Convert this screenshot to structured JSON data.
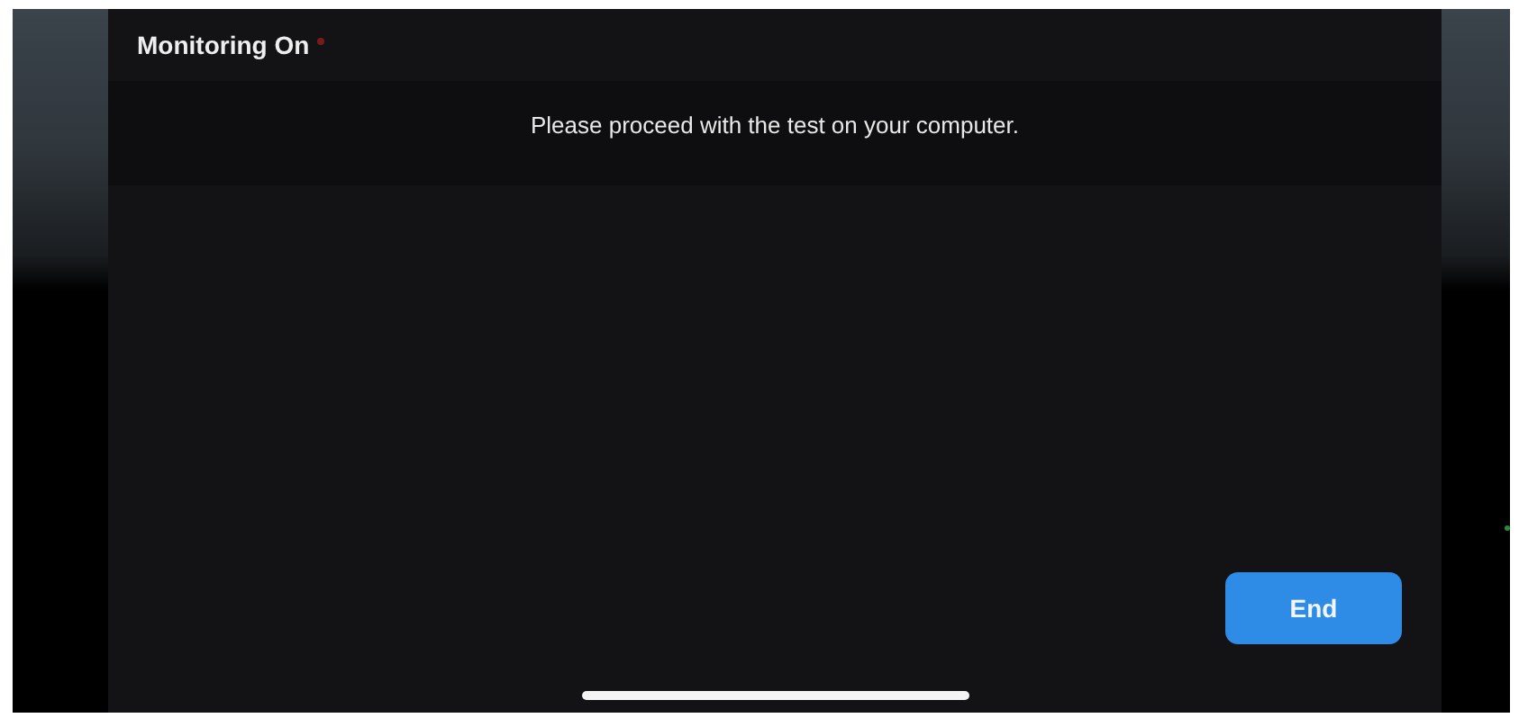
{
  "header": {
    "title": "Monitoring On",
    "indicator_on": true
  },
  "message": "Please proceed with the test on your computer.",
  "buttons": [
    {
      "label": "End"
    }
  ]
}
